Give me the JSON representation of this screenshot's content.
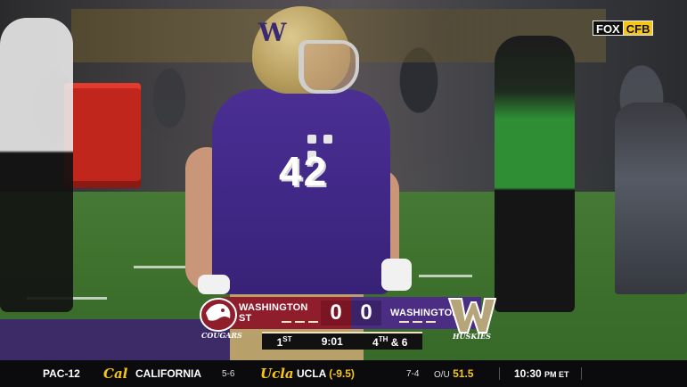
{
  "network": {
    "fox": "FOX",
    "cfb": "CFB"
  },
  "player": {
    "helmet_letter": "W",
    "jersey_number": "42"
  },
  "scorebug": {
    "away": {
      "name": "WASHINGTON ST",
      "score": "0",
      "logo_text": "COUGARS",
      "color": "#8f1d2c"
    },
    "home": {
      "name": "WASHINGTON",
      "score": "0",
      "logo_text": "HUSKIES",
      "color": "#4b2e83"
    },
    "quarter": "1",
    "quarter_suffix": "ST",
    "clock": "9:01",
    "down": "4",
    "down_suffix": "TH",
    "distance": "& 6"
  },
  "ticker": {
    "conference": "PAC-12",
    "team1_logo": "Cal",
    "team1": "CALIFORNIA",
    "team1_rank": "5-6",
    "team2_logo": "Ucla",
    "team2": "UCLA",
    "team2_spread": "(-9.5)",
    "team2_rank": "7-4",
    "ou_label": "O/U",
    "ou_value": "51.5",
    "time": "10:30",
    "tz": "PM ET"
  },
  "colors": {
    "cfb_yellow": "#f5c518",
    "uw_gold": "#b7a57a"
  }
}
